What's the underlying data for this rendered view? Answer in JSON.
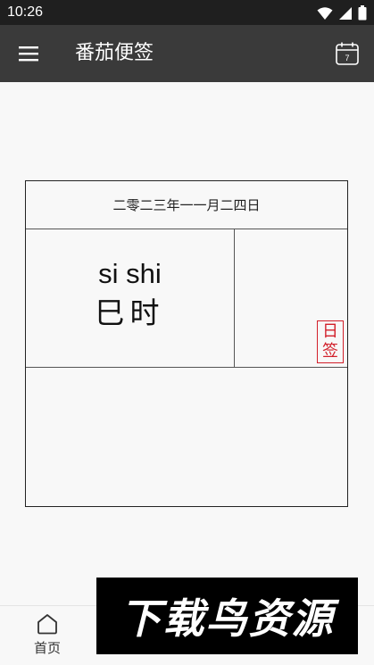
{
  "status_bar": {
    "time": "10:26"
  },
  "app_bar": {
    "title": "番茄便签",
    "calendar_day": "7"
  },
  "note": {
    "date": "二零二三年一一月二四日",
    "pinyin": "si shi",
    "hour_name": "巳时",
    "stamp_chars": [
      "日",
      "签"
    ]
  },
  "bottom_nav": {
    "home_label": "首页"
  },
  "watermark": {
    "text": "下载鸟资源"
  },
  "colors": {
    "app_bar": "#3a3a3a",
    "status_bar": "#1f1f1f",
    "stamp": "#d21f2a"
  }
}
